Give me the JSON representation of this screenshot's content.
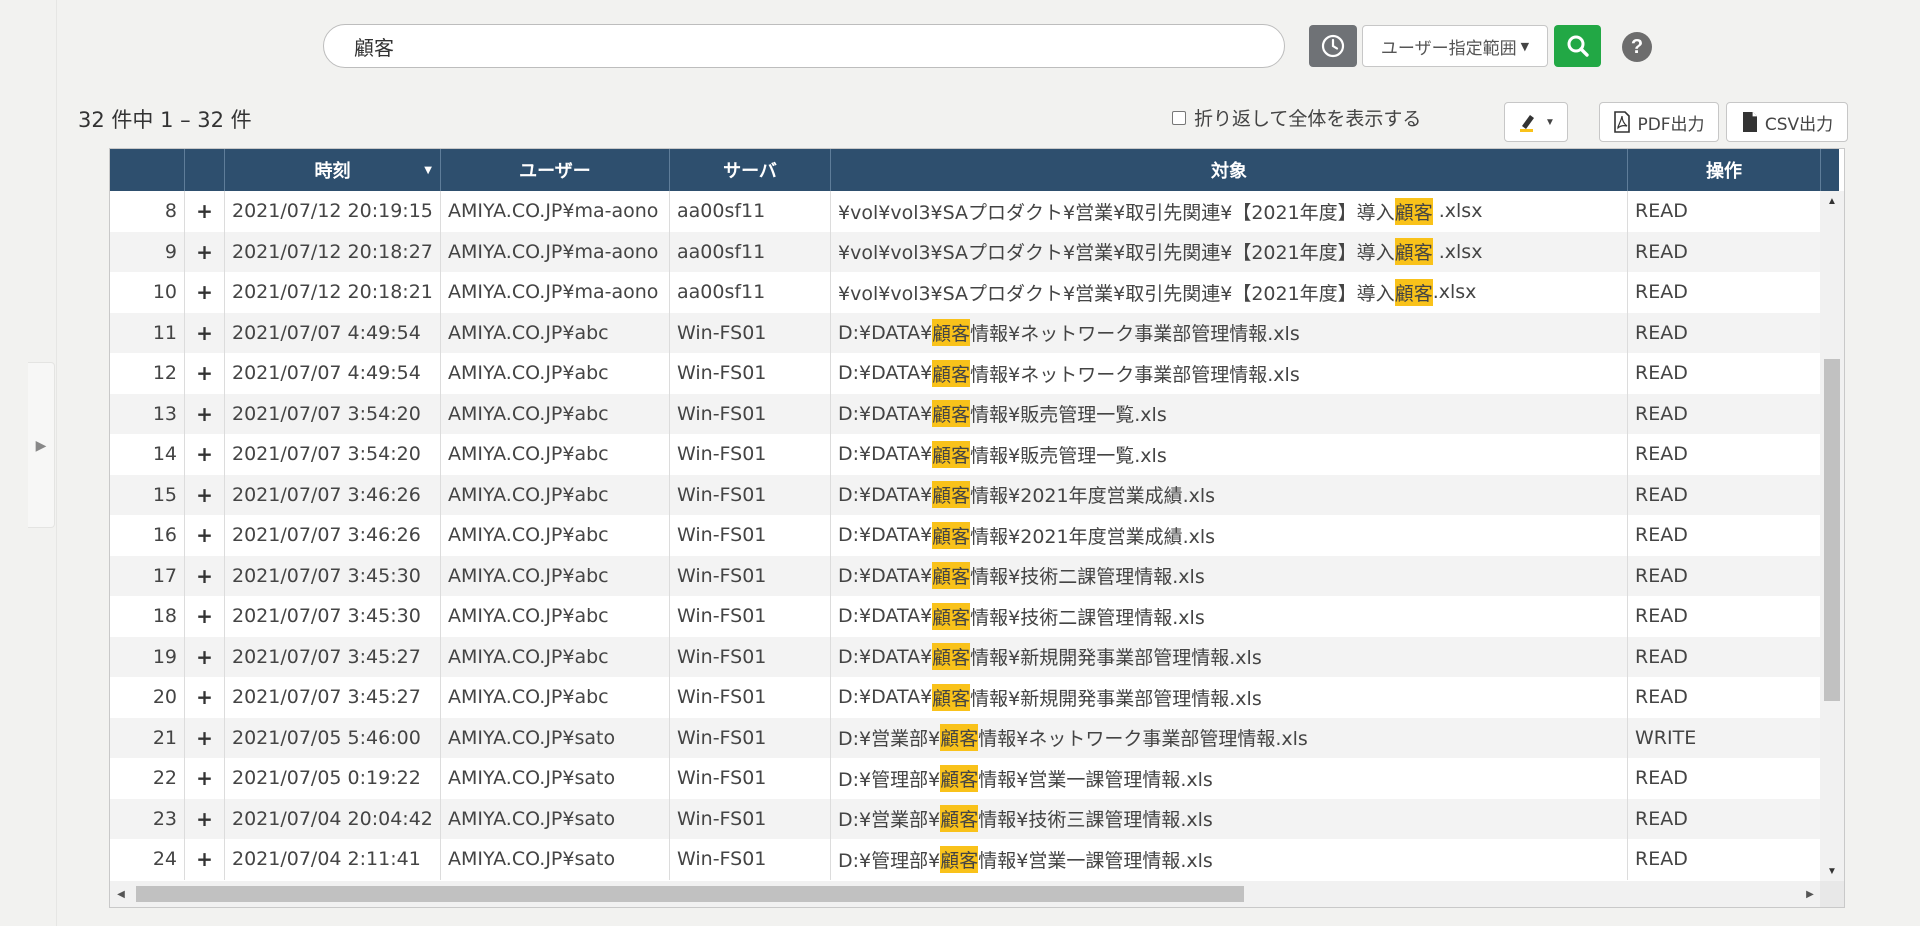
{
  "search": {
    "value": "顧客"
  },
  "toolbar": {
    "range_label": "ユーザー指定範囲",
    "help_label": "?"
  },
  "results": {
    "count_label": "32 件中 1 – 32 件",
    "wrap_label": "折り返して全体を表示する",
    "pdf_label": "PDF出力",
    "csv_label": "CSV出力"
  },
  "table": {
    "columns": [
      "",
      "",
      "時刻",
      "ユーザー",
      "サーバ",
      "対象",
      "操作"
    ],
    "highlight_term": "顧客",
    "rows": [
      {
        "num": "8",
        "time": "2021/07/12 20:19:15",
        "user": "AMIYA.CO.JP¥ma-aono",
        "server": "aa00sf11",
        "target": [
          "¥vol¥vol3¥SAプロダクト¥営業¥取引先関連¥【2021年度】導入",
          "顧客",
          " .xlsx"
        ],
        "op": "READ"
      },
      {
        "num": "9",
        "time": "2021/07/12 20:18:27",
        "user": "AMIYA.CO.JP¥ma-aono",
        "server": "aa00sf11",
        "target": [
          "¥vol¥vol3¥SAプロダクト¥営業¥取引先関連¥【2021年度】導入",
          "顧客",
          " .xlsx"
        ],
        "op": "READ"
      },
      {
        "num": "10",
        "time": "2021/07/12 20:18:21",
        "user": "AMIYA.CO.JP¥ma-aono",
        "server": "aa00sf11",
        "target": [
          "¥vol¥vol3¥SAプロダクト¥営業¥取引先関連¥【2021年度】導入",
          "顧客",
          ".xlsx"
        ],
        "op": "READ"
      },
      {
        "num": "11",
        "time": "2021/07/07 4:49:54",
        "user": "AMIYA.CO.JP¥abc",
        "server": "Win-FS01",
        "target": [
          "D:¥DATA¥",
          "顧客",
          "情報¥ネットワーク事業部管理情報.xls"
        ],
        "op": "READ"
      },
      {
        "num": "12",
        "time": "2021/07/07 4:49:54",
        "user": "AMIYA.CO.JP¥abc",
        "server": "Win-FS01",
        "target": [
          "D:¥DATA¥",
          "顧客",
          "情報¥ネットワーク事業部管理情報.xls"
        ],
        "op": "READ"
      },
      {
        "num": "13",
        "time": "2021/07/07 3:54:20",
        "user": "AMIYA.CO.JP¥abc",
        "server": "Win-FS01",
        "target": [
          "D:¥DATA¥",
          "顧客",
          "情報¥販売管理一覧.xls"
        ],
        "op": "READ"
      },
      {
        "num": "14",
        "time": "2021/07/07 3:54:20",
        "user": "AMIYA.CO.JP¥abc",
        "server": "Win-FS01",
        "target": [
          "D:¥DATA¥",
          "顧客",
          "情報¥販売管理一覧.xls"
        ],
        "op": "READ"
      },
      {
        "num": "15",
        "time": "2021/07/07 3:46:26",
        "user": "AMIYA.CO.JP¥abc",
        "server": "Win-FS01",
        "target": [
          "D:¥DATA¥",
          "顧客",
          "情報¥2021年度営業成績.xls"
        ],
        "op": "READ"
      },
      {
        "num": "16",
        "time": "2021/07/07 3:46:26",
        "user": "AMIYA.CO.JP¥abc",
        "server": "Win-FS01",
        "target": [
          "D:¥DATA¥",
          "顧客",
          "情報¥2021年度営業成績.xls"
        ],
        "op": "READ"
      },
      {
        "num": "17",
        "time": "2021/07/07 3:45:30",
        "user": "AMIYA.CO.JP¥abc",
        "server": "Win-FS01",
        "target": [
          "D:¥DATA¥",
          "顧客",
          "情報¥技術二課管理情報.xls"
        ],
        "op": "READ"
      },
      {
        "num": "18",
        "time": "2021/07/07 3:45:30",
        "user": "AMIYA.CO.JP¥abc",
        "server": "Win-FS01",
        "target": [
          "D:¥DATA¥",
          "顧客",
          "情報¥技術二課管理情報.xls"
        ],
        "op": "READ"
      },
      {
        "num": "19",
        "time": "2021/07/07 3:45:27",
        "user": "AMIYA.CO.JP¥abc",
        "server": "Win-FS01",
        "target": [
          "D:¥DATA¥",
          "顧客",
          "情報¥新規開発事業部管理情報.xls"
        ],
        "op": "READ"
      },
      {
        "num": "20",
        "time": "2021/07/07 3:45:27",
        "user": "AMIYA.CO.JP¥abc",
        "server": "Win-FS01",
        "target": [
          "D:¥DATA¥",
          "顧客",
          "情報¥新規開発事業部管理情報.xls"
        ],
        "op": "READ"
      },
      {
        "num": "21",
        "time": "2021/07/05 5:46:00",
        "user": "AMIYA.CO.JP¥sato",
        "server": "Win-FS01",
        "target": [
          "D:¥営業部¥",
          "顧客",
          "情報¥ネットワーク事業部管理情報.xls"
        ],
        "op": "WRITE"
      },
      {
        "num": "22",
        "time": "2021/07/05 0:19:22",
        "user": "AMIYA.CO.JP¥sato",
        "server": "Win-FS01",
        "target": [
          "D:¥管理部¥",
          "顧客",
          "情報¥営業一課管理情報.xls"
        ],
        "op": "READ"
      },
      {
        "num": "23",
        "time": "2021/07/04 20:04:42",
        "user": "AMIYA.CO.JP¥sato",
        "server": "Win-FS01",
        "target": [
          "D:¥営業部¥",
          "顧客",
          "情報¥技術三課管理情報.xls"
        ],
        "op": "READ"
      },
      {
        "num": "24",
        "time": "2021/07/04 2:11:41",
        "user": "AMIYA.CO.JP¥sato",
        "server": "Win-FS01",
        "target": [
          "D:¥管理部¥",
          "顧客",
          "情報¥営業一課管理情報.xls"
        ],
        "op": "READ"
      }
    ]
  },
  "colors": {
    "header_bg": "#2e4f6e",
    "highlight": "#f9c21a",
    "search_button": "#22a845",
    "history_button": "#6f7276"
  },
  "icons": {
    "history": "clock-icon",
    "search": "magnifier-icon",
    "help": "question-icon",
    "pdf": "pdf-file-icon",
    "csv": "csv-file-icon",
    "marker": "highlighter-icon",
    "expand": "plus-icon"
  }
}
